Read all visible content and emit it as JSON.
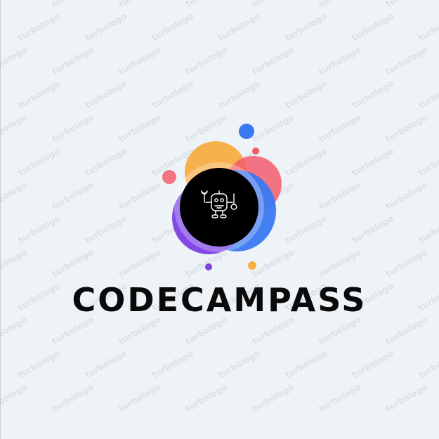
{
  "logo": {
    "brand_name": "CODECAMPASS",
    "icon": "robot-with-wrenches-icon",
    "colors": {
      "background": "#eef3f7",
      "text": "#0a0a0a",
      "orange": "#f6ad43",
      "red": "#f25c6c",
      "blue": "#3a78f2",
      "purple": "#7b3fe4",
      "black": "#000000"
    }
  },
  "watermark": {
    "text": "turbologo"
  }
}
